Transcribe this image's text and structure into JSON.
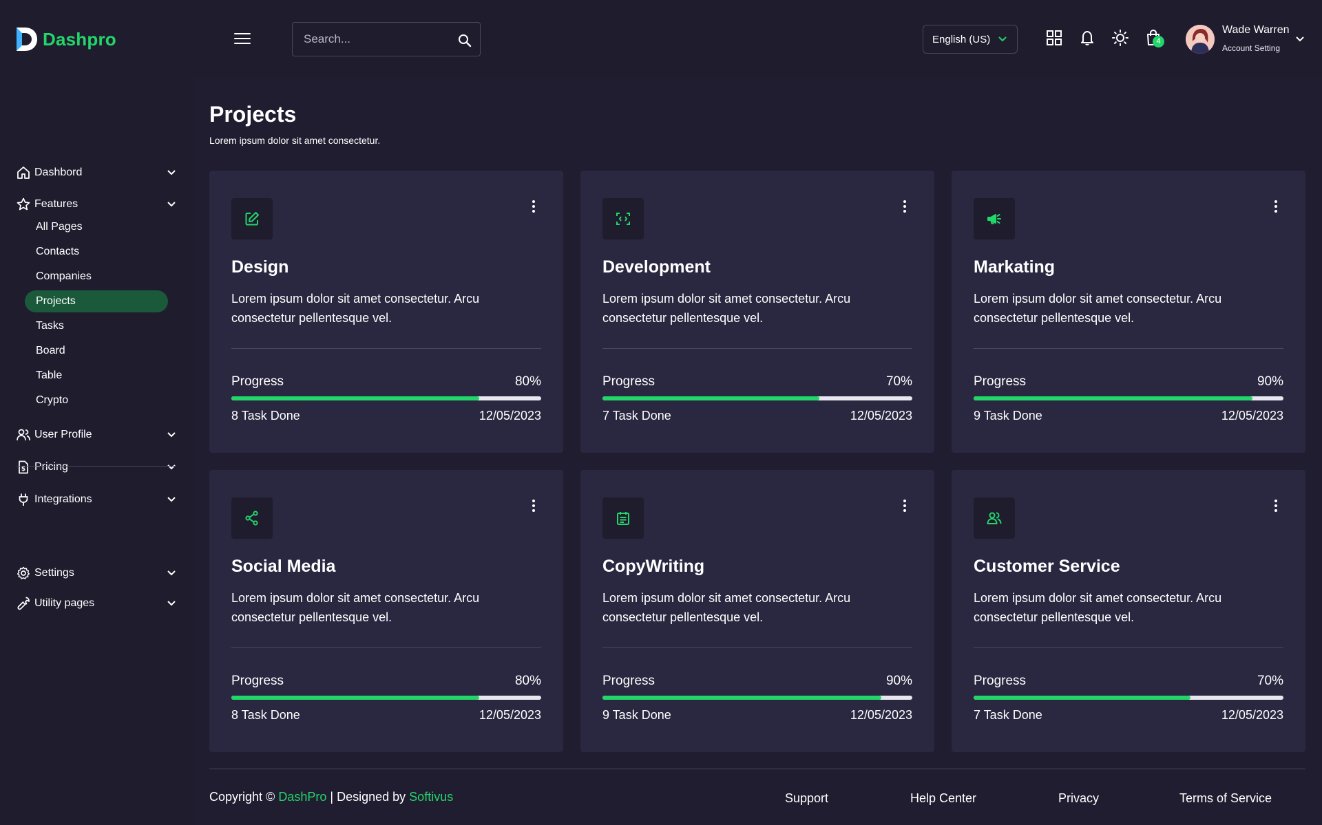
{
  "brand": {
    "name": "Dashpro",
    "accent": "#22d66a",
    "background": "#201d30",
    "panel": "#1f1c2e",
    "card": "#2a2740"
  },
  "header": {
    "search_placeholder": "Search...",
    "language": "English (US)",
    "icons": [
      "grid-icon",
      "bell-icon",
      "sun-icon",
      "cart-icon"
    ],
    "cart_badge": "4",
    "user": {
      "name": "Wade Warren",
      "subtitle": "Account Setting"
    }
  },
  "sidebar": {
    "items": [
      {
        "label": "Dashbord",
        "icon": "home-icon"
      },
      {
        "label": "Features",
        "icon": "star-icon"
      },
      {
        "label": "User Profile",
        "icon": "users-icon"
      },
      {
        "label": "Pricing",
        "icon": "price-doc-icon"
      },
      {
        "label": "Integrations",
        "icon": "plug-icon"
      },
      {
        "label": "Settings",
        "icon": "gear-icon"
      },
      {
        "label": "Utility pages",
        "icon": "wrench-icon"
      }
    ],
    "features_sub": [
      "All Pages",
      "Contacts",
      "Companies",
      "Projects",
      "Tasks",
      "Board",
      "Table",
      "Crypto"
    ],
    "active_sub": "Projects"
  },
  "page": {
    "title": "Projects",
    "subtitle": "Lorem ipsum dolor sit amet consectetur."
  },
  "cards": [
    {
      "title": "Design",
      "icon": "edit-icon",
      "desc": "Lorem ipsum dolor sit amet consectetur. Arcu consectetur pellentesque vel.",
      "progress_label": "Progress",
      "progress_text": "80%",
      "progress": 0.8,
      "tasks": "8 Task Done",
      "date": "12/05/2023"
    },
    {
      "title": "Development",
      "icon": "code-scan-icon",
      "desc": "Lorem ipsum dolor sit amet consectetur. Arcu consectetur pellentesque vel.",
      "progress_label": "Progress",
      "progress_text": "70%",
      "progress": 0.7,
      "tasks": "7 Task Done",
      "date": "12/05/2023"
    },
    {
      "title": "Markating",
      "icon": "megaphone-icon",
      "desc": "Lorem ipsum dolor sit amet consectetur. Arcu consectetur pellentesque vel.",
      "progress_label": "Progress",
      "progress_text": "90%",
      "progress": 0.9,
      "tasks": "9 Task Done",
      "date": "12/05/2023"
    },
    {
      "title": "Social Media",
      "icon": "share-icon",
      "desc": "Lorem ipsum dolor sit amet consectetur. Arcu consectetur pellentesque vel.",
      "progress_label": "Progress",
      "progress_text": "80%",
      "progress": 0.8,
      "tasks": "8 Task Done",
      "date": "12/05/2023"
    },
    {
      "title": "CopyWriting",
      "icon": "calendar-icon",
      "desc": "Lorem ipsum dolor sit amet consectetur. Arcu consectetur pellentesque vel.",
      "progress_label": "Progress",
      "progress_text": "90%",
      "progress": 0.9,
      "tasks": "9 Task Done",
      "date": "12/05/2023"
    },
    {
      "title": "Customer Service",
      "icon": "people-icon",
      "desc": "Lorem ipsum dolor sit amet consectetur. Arcu consectetur pellentesque vel.",
      "progress_label": "Progress",
      "progress_text": "70%",
      "progress": 0.7,
      "tasks": "7 Task Done",
      "date": "12/05/2023"
    }
  ],
  "footer": {
    "copyright_prefix": "Copyright ©",
    "brand": "DashPro",
    "separator": "|",
    "designed_by": "Designed by",
    "designer": "Softivus",
    "links": [
      "Support",
      "Help Center",
      "Privacy",
      "Terms of Service"
    ]
  }
}
